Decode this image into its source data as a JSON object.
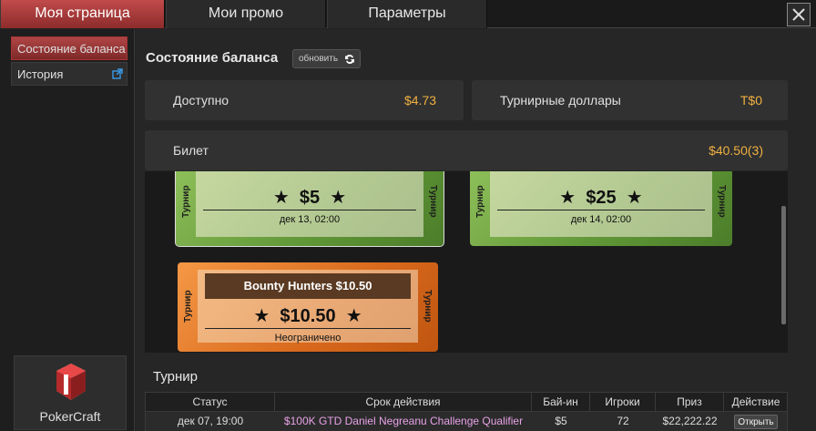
{
  "tabs": [
    {
      "label": "Моя страница",
      "active": true
    },
    {
      "label": "Мои промо",
      "active": false
    },
    {
      "label": "Параметры",
      "active": false
    }
  ],
  "sidebar": {
    "items": [
      {
        "label": "Состояние баланса",
        "active": true
      },
      {
        "label": "История",
        "active": false,
        "icon": "external-link-icon"
      }
    ],
    "pokercraft_label": "PokerCraft"
  },
  "balance": {
    "title": "Состояние баланса",
    "refresh_label": "обновить",
    "available_label": "Доступно",
    "available_value": "$4.73",
    "tournament_dollars_label": "Турнирные доллары",
    "tournament_dollars_value": "T$0",
    "ticket_label": "Билет",
    "ticket_value": "$40.50(3)"
  },
  "tickets": [
    {
      "side_label": "Турнир",
      "amount": "$5",
      "date": "дек 13, 02:00",
      "color": "green"
    },
    {
      "side_label": "Турнир",
      "amount": "$25",
      "date": "дек 14, 02:00",
      "color": "green"
    },
    {
      "side_label": "Турнир",
      "name": "Bounty Hunters $10.50",
      "amount": "$10.50",
      "date": "Неограничено",
      "color": "orange"
    }
  ],
  "tournament": {
    "title": "Турнир",
    "columns": [
      "Статус",
      "Срок действия",
      "Бай-ин",
      "Игроки",
      "Приз",
      "Действие"
    ],
    "rows": [
      {
        "status": "дек 07, 19:00",
        "name": "$100K GTD Daniel Negreanu Challenge Qualifier",
        "buyin": "$5",
        "players": "72",
        "prize": "$22,222.22",
        "action": "Открыть"
      }
    ]
  },
  "colors": {
    "accent": "#a83a3a",
    "value": "#f0b040",
    "link": "#e7a2e7"
  }
}
